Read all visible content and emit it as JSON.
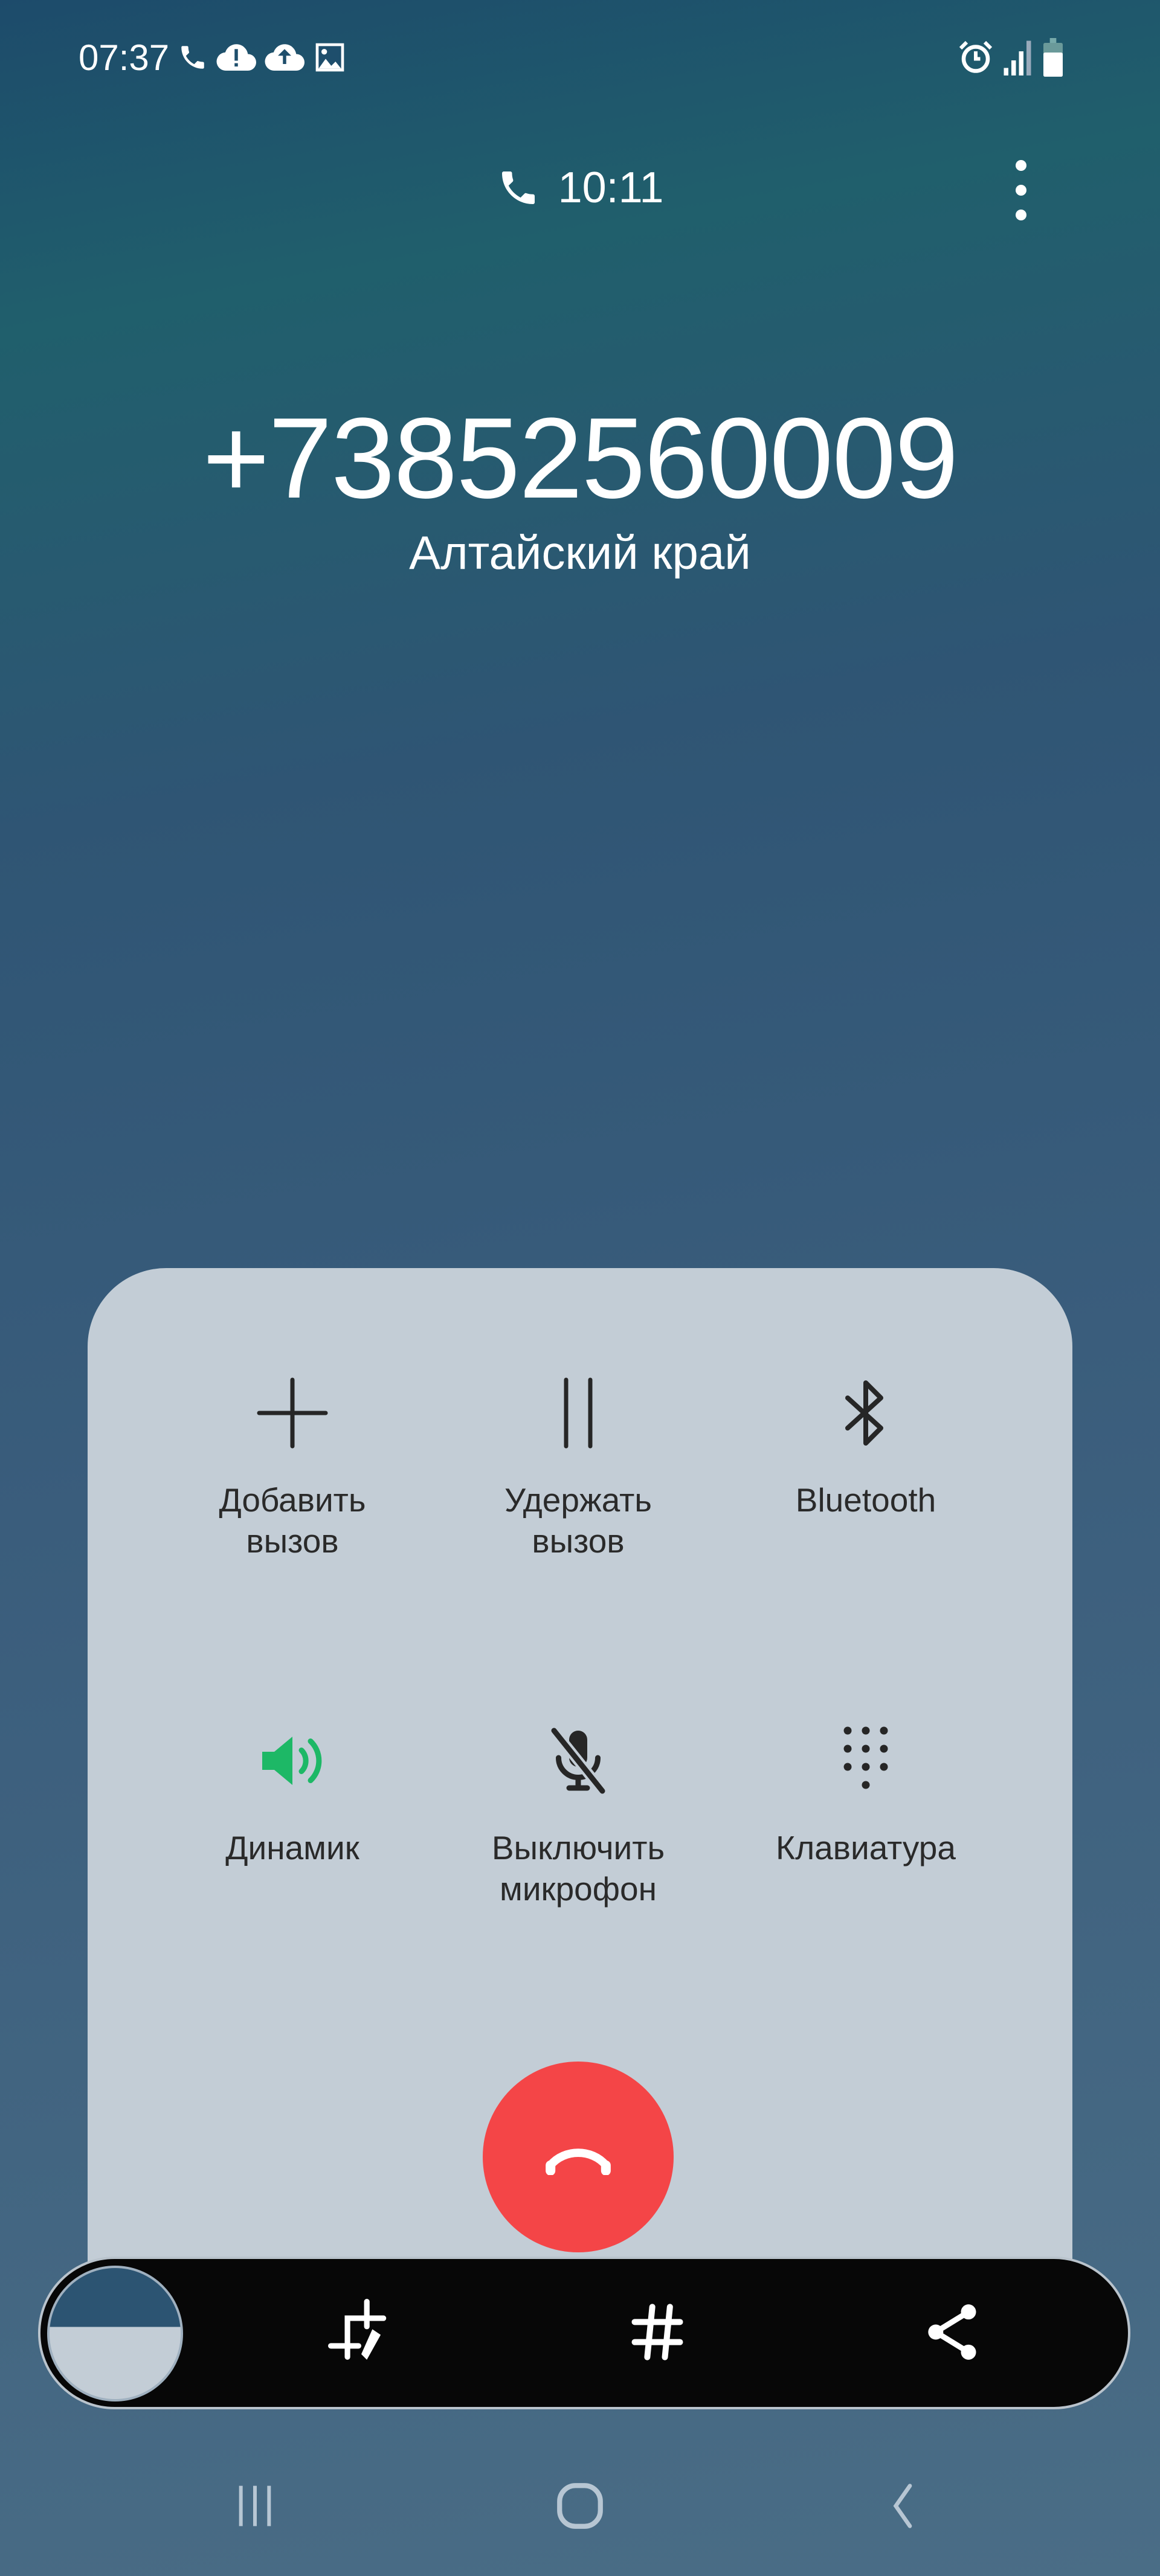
{
  "status_bar": {
    "time": "07:37",
    "icons_left": [
      "phone-icon",
      "cloud-alert-icon",
      "cloud-upload-icon",
      "image-icon"
    ],
    "icons_right": [
      "alarm-icon",
      "signal-icon",
      "battery-icon"
    ]
  },
  "call": {
    "duration": "10:11",
    "number": "+73852560009",
    "region": "Алтайский край"
  },
  "controls": [
    {
      "icon": "plus-icon",
      "label1": "Добавить",
      "label2": "вызов"
    },
    {
      "icon": "pause-icon",
      "label1": "Удержать",
      "label2": "вызов"
    },
    {
      "icon": "bluetooth-icon",
      "label1": "Bluetooth",
      "label2": ""
    },
    {
      "icon": "speaker-icon",
      "label1": "Динамик",
      "label2": "",
      "active": true
    },
    {
      "icon": "mic-off-icon",
      "label1": "Выключить",
      "label2": "микрофон"
    },
    {
      "icon": "keypad-icon",
      "label1": "Клавиатура",
      "label2": ""
    }
  ],
  "colors": {
    "speaker_active": "#1db866",
    "end_call": "#f44547",
    "panel": "#c3cdd6"
  },
  "screenshot_toolbar": {
    "icons": [
      "crop-edit-icon",
      "hashtag-icon",
      "share-icon"
    ]
  },
  "nav_bar": {
    "icons": [
      "recents-icon",
      "home-icon",
      "back-icon"
    ]
  }
}
